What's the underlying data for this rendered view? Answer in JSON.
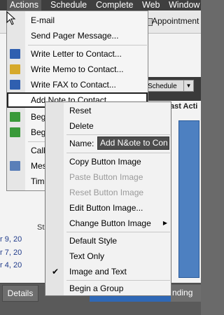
{
  "menubar": {
    "items": [
      {
        "label": "Actions"
      },
      {
        "label": "Schedule"
      },
      {
        "label": "Complete"
      },
      {
        "label": "Web"
      },
      {
        "label": "Window"
      }
    ]
  },
  "background": {
    "toolbar_appointment": "Appointment",
    "schedule_dropdown": "Schedule",
    "last_activity_label": "ast Acti",
    "dates": [
      "r 9, 20",
      "r 7, 20",
      "r 4, 20"
    ],
    "st_label": "St",
    "bottom_tabs": [
      "Details",
      "nding"
    ]
  },
  "actions_menu": {
    "items": [
      {
        "label": "E-mail",
        "icon": "blank"
      },
      {
        "label": "Send Pager Message...",
        "icon": "blank"
      },
      {
        "label": "Write Letter to Contact...",
        "icon": "letter-icon"
      },
      {
        "label": "Write Memo to Contact...",
        "icon": "memo-icon"
      },
      {
        "label": "Write FAX to Contact...",
        "icon": "fax-icon"
      },
      {
        "label": "Add Note to Contact...",
        "icon": "note-icon"
      },
      {
        "label": "Begi",
        "icon": "begin-icon"
      },
      {
        "label": "Begi",
        "icon": "begin-icon"
      },
      {
        "label": "Call",
        "icon": "blank"
      },
      {
        "label": "Mes",
        "icon": "message-icon"
      },
      {
        "label": "Time",
        "icon": "blank"
      }
    ]
  },
  "context_menu": {
    "reset": "Reset",
    "delete": "Delete",
    "name_label": "Name:",
    "name_value": "Add N&ote to Con",
    "copy_image": "Copy Button Image",
    "paste_image": "Paste Button Image",
    "reset_image": "Reset Button Image",
    "edit_image": "Edit Button Image...",
    "change_image": "Change Button Image",
    "default_style": "Default Style",
    "text_only": "Text Only",
    "image_and_text": "Image and Text",
    "begin_group": "Begin a Group"
  },
  "colors": {
    "menubar_bg": "#3f3f3f",
    "accent_blue": "#4d80c1",
    "name_field_bg": "#4d4d4d"
  }
}
